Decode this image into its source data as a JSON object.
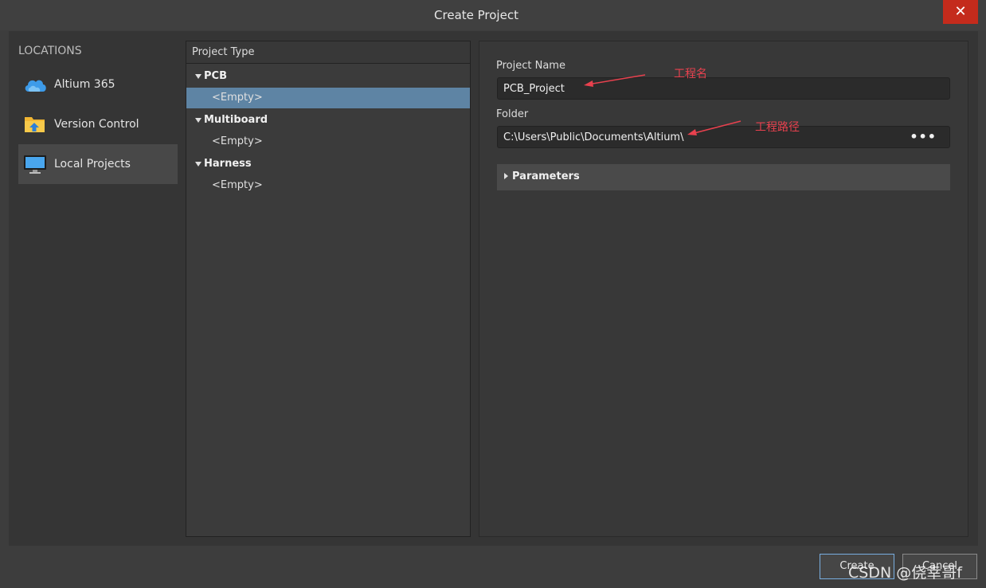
{
  "window": {
    "title": "Create Project",
    "close_glyph": "✕"
  },
  "locations": {
    "title": "LOCATIONS",
    "items": [
      {
        "label": "Altium 365",
        "icon": "cloud-icon"
      },
      {
        "label": "Version Control",
        "icon": "folder-upload-icon"
      },
      {
        "label": "Local Projects",
        "icon": "monitor-icon"
      }
    ]
  },
  "project_type": {
    "header": "Project Type",
    "groups": [
      {
        "label": "PCB",
        "items": [
          "<Empty>"
        ]
      },
      {
        "label": "Multiboard",
        "items": [
          "<Empty>"
        ]
      },
      {
        "label": "Harness",
        "items": [
          "<Empty>"
        ]
      }
    ]
  },
  "form": {
    "name_label": "Project Name",
    "name_value": "PCB_Project",
    "folder_label": "Folder",
    "folder_value": "C:\\Users\\Public\\Documents\\Altium\\",
    "browse_glyph": "•••",
    "parameters_label": "Parameters"
  },
  "annotations": {
    "name_note": "工程名",
    "folder_note": "工程路径",
    "color": "#e8414e"
  },
  "buttons": {
    "create": "Create",
    "cancel": "Cancel"
  },
  "watermark": "CSDN @侥幸哥f",
  "colors": {
    "selected_row": "#5e84a4",
    "close_button": "#c42b1c",
    "accent_border": "#79aee0"
  }
}
